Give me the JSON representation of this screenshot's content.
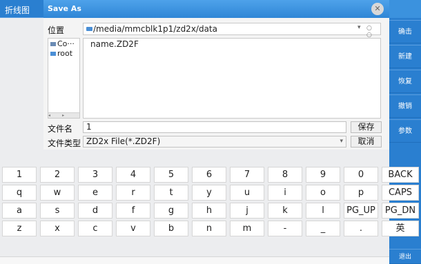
{
  "left_tab": {
    "label": "折线图"
  },
  "dialog": {
    "title": "Save As",
    "location_label": "位置",
    "path": "/media/mmcblk1p1/zd2x/data",
    "nav_icons": "○ ○ ○ ⊘ ▤ ▥",
    "tree": [
      {
        "label": "Co···"
      },
      {
        "label": "root"
      }
    ],
    "files": [
      "name.ZD2F"
    ],
    "filename_label": "文件名",
    "filename_value": "1",
    "save_label": "保存",
    "filetype_label": "文件类型",
    "filetype_value": "ZD2x File(*.ZD2F)",
    "cancel_label": "取消"
  },
  "right_panel": {
    "buttons": [
      "确击",
      "新建",
      "恢复",
      "撤销",
      "参数"
    ],
    "exit_label": "退出"
  },
  "keyboard": {
    "rows": [
      [
        "1",
        "2",
        "3",
        "4",
        "5",
        "6",
        "7",
        "8",
        "9",
        "0",
        "BACK"
      ],
      [
        "q",
        "w",
        "e",
        "r",
        "t",
        "y",
        "u",
        "i",
        "o",
        "p",
        "CAPS"
      ],
      [
        "a",
        "s",
        "d",
        "f",
        "g",
        "h",
        "j",
        "k",
        "l",
        "PG_UP",
        "PG_DN"
      ],
      [
        "z",
        "x",
        "c",
        "v",
        "b",
        "n",
        "m",
        "-",
        "_",
        ".",
        "英"
      ]
    ]
  }
}
